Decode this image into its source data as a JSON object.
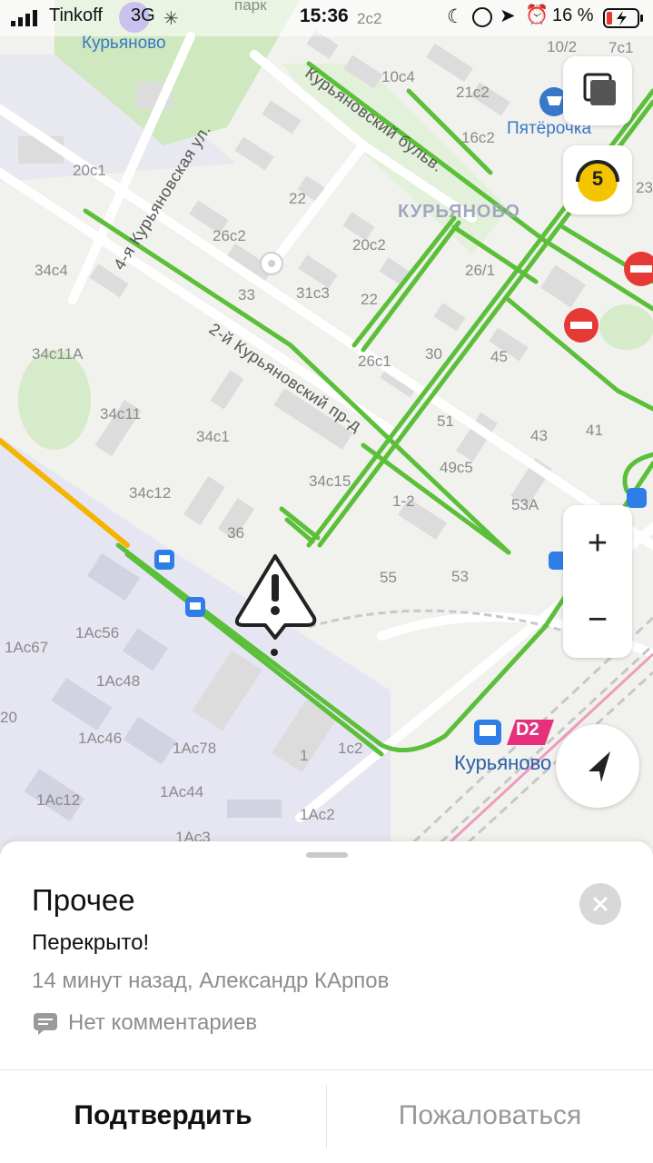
{
  "status_bar": {
    "carrier": "Tinkoff",
    "network": "3G",
    "time": "15:36",
    "battery": "16 %"
  },
  "map": {
    "district_labels": {
      "top": "Курьяново",
      "center": "КУРЬЯНОВО",
      "park": "парк"
    },
    "streets": {
      "bulvar": "Курьяновский бульв.",
      "ulitsa": "4-я Курьяновская ул.",
      "proezd": "2-й Курьяновский пр-д"
    },
    "poi": {
      "shop": "Пятёрочка",
      "station": "Курьяново",
      "station_line": "D2"
    },
    "buildings": [
      "2с2",
      "10/2",
      "7с1",
      "10с4",
      "21с2",
      "16с2",
      "20с1",
      "22",
      "26с2",
      "20с2",
      "23",
      "34с4",
      "33",
      "31с3",
      "22",
      "26/1",
      "34с11А",
      "26с1",
      "30",
      "45",
      "34с11",
      "51",
      "43",
      "41",
      "34с1",
      "49с5",
      "34с12",
      "34с15",
      "1-2",
      "53А",
      "36",
      "55",
      "53",
      "1Ас56",
      "1Ас67",
      "1Ас48",
      "20",
      "1Ас46",
      "1Ас78",
      "1",
      "1с2",
      "1Ас12",
      "1Ас44",
      "1Ас2",
      "1Ас3"
    ],
    "traffic_level": "5"
  },
  "controls": {
    "zoom_in": "+",
    "zoom_out": "−"
  },
  "event": {
    "title": "Прочее",
    "status": "Перекрыто!",
    "meta": "14 минут назад, Александр КАрпов",
    "comments": "Нет комментариев",
    "confirm_label": "Подтвердить",
    "report_label": "Пожаловаться"
  },
  "colors": {
    "traffic_free": "#5cbf3a",
    "traffic_slow": "#f5b400",
    "closure": "#e53935",
    "accent_blue": "#3978c8",
    "rail_d2": "#e6307d"
  }
}
